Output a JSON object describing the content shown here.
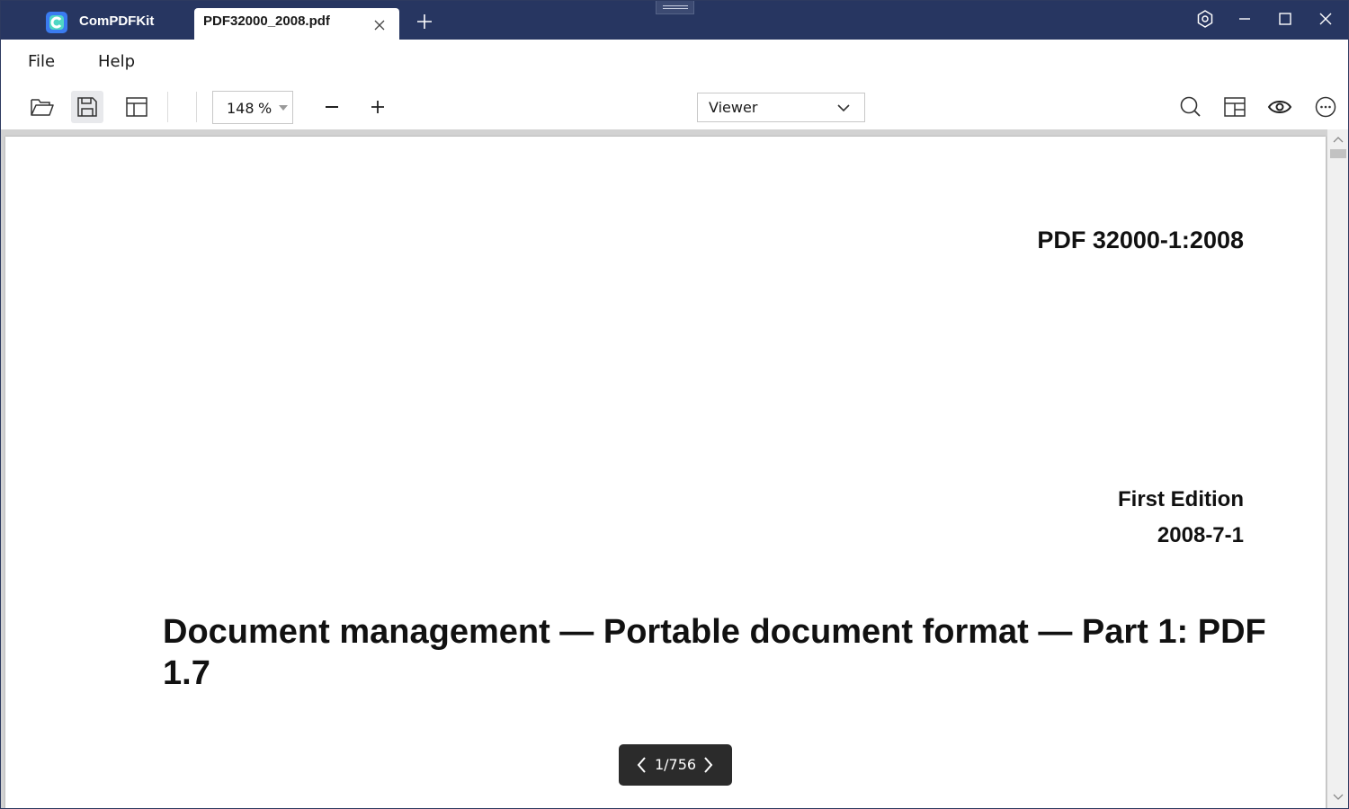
{
  "app": {
    "name": "ComPDFKit",
    "logo_color": "#2f8cf0",
    "titlebar_color": "#273661"
  },
  "tabs": [
    {
      "title": "PDF32000_2008.pdf",
      "active": true
    }
  ],
  "menu": {
    "items": [
      {
        "label": "File"
      },
      {
        "label": "Help"
      }
    ]
  },
  "toolbar": {
    "left_icons": [
      "open-folder-icon",
      "save-icon",
      "layout-icon"
    ],
    "zoom": {
      "value": "148",
      "unit": "%"
    },
    "mode": {
      "selected": "Viewer"
    },
    "right_icons": [
      "search-icon",
      "panel-layout-icon",
      "eye-icon",
      "more-icon"
    ]
  },
  "document": {
    "id": "PDF 32000-1:2008",
    "edition": "First Edition",
    "date": "2008-7-1",
    "title": "Document management — Portable document format — Part 1: PDF 1.7"
  },
  "pager": {
    "text": "1/756",
    "current_page": 1,
    "total_pages": 756
  }
}
